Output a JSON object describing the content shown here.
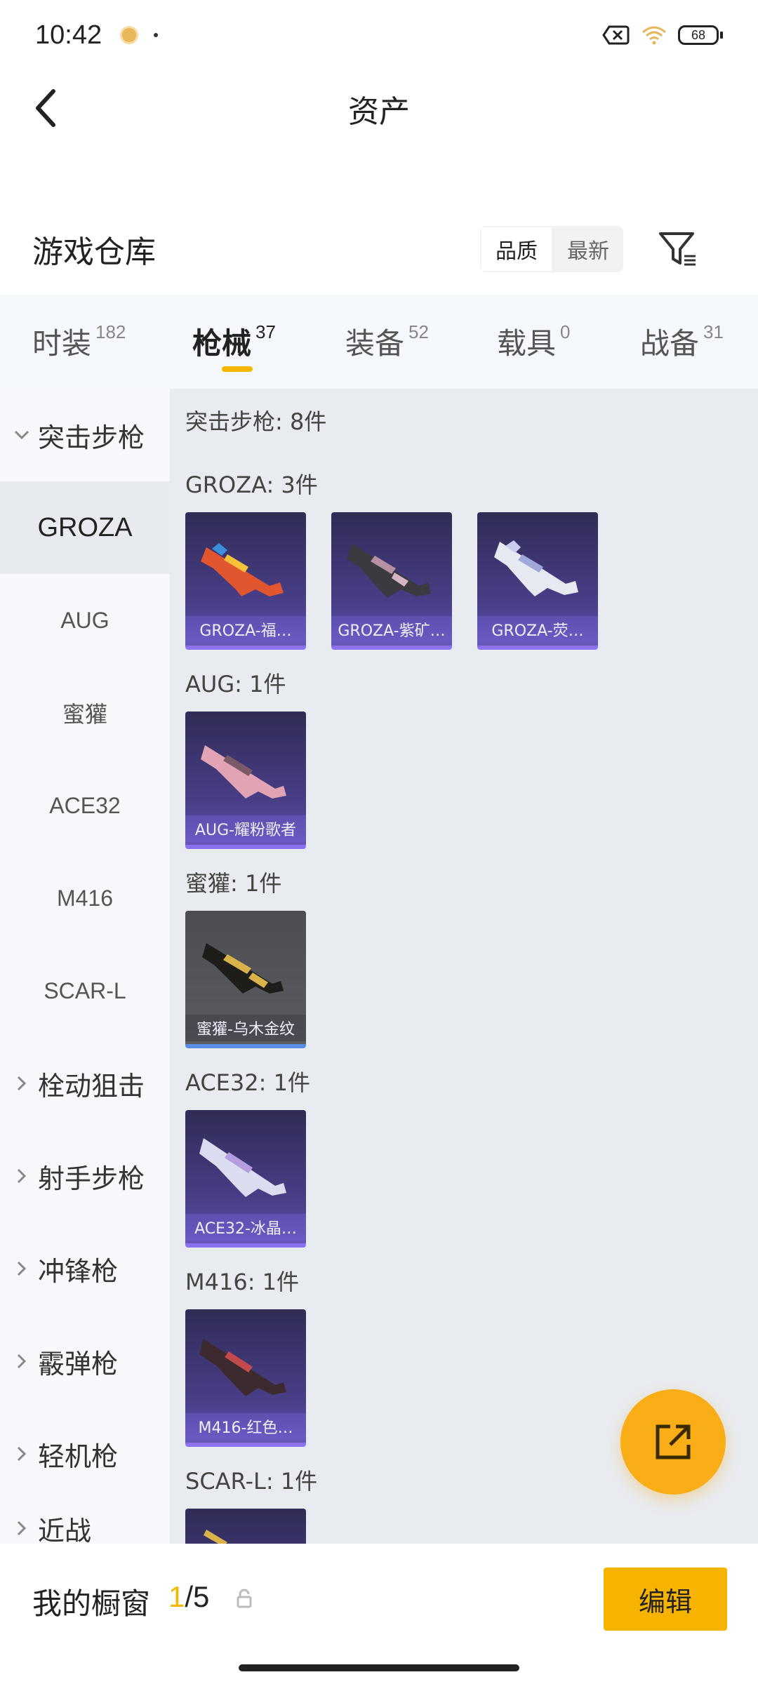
{
  "status_bar": {
    "time": "10:42",
    "battery": "68",
    "icons": [
      "notification-icon",
      "close-box-icon",
      "wifi-icon",
      "battery-icon"
    ]
  },
  "header": {
    "title": "资产",
    "back_icon": "chevron-left-icon"
  },
  "warehouse": {
    "title": "游戏仓库",
    "sort_options": [
      "品质",
      "最新"
    ],
    "sort_selected": "品质",
    "filter_icon": "filter-icon"
  },
  "tabs": [
    {
      "label": "时装",
      "count": "182"
    },
    {
      "label": "枪械",
      "count": "37"
    },
    {
      "label": "装备",
      "count": "52"
    },
    {
      "label": "载具",
      "count": "0"
    },
    {
      "label": "战备",
      "count": "31"
    }
  ],
  "active_tab": "枪械",
  "sidebar": {
    "expanded_category": "突击步枪",
    "subcategories": [
      "GROZA",
      "AUG",
      "蜜獾",
      "ACE32",
      "M416",
      "SCAR-L"
    ],
    "active_subcategory": "GROZA",
    "other_categories": [
      "栓动狙击",
      "射手步枪",
      "冲锋枪",
      "霰弹枪",
      "轻机枪",
      "近战"
    ]
  },
  "content": {
    "category_header": "突击步枪: 8件",
    "groups": [
      {
        "header": "GROZA: 3件",
        "items": [
          "GROZA-福…",
          "GROZA-紫矿…",
          "GROZA-荧…"
        ]
      },
      {
        "header": "AUG: 1件",
        "items": [
          "AUG-耀粉歌者"
        ]
      },
      {
        "header": "蜜獾: 1件",
        "items": [
          "蜜獾-乌木金纹"
        ]
      },
      {
        "header": "ACE32: 1件",
        "items": [
          "ACE32-冰晶…"
        ]
      },
      {
        "header": "M416: 1件",
        "items": [
          "M416-红色…"
        ]
      },
      {
        "header": "SCAR-L: 1件",
        "items": [
          ""
        ]
      }
    ]
  },
  "share_fab_icon": "share-icon",
  "bottom_bar": {
    "showcase_label": "我的橱窗",
    "showcase_current": "1",
    "showcase_total": "/5",
    "lock_icon": "lock-icon",
    "edit_label": "编辑"
  },
  "colors": {
    "accent": "#f6b400",
    "tab_bg": "#f5f8fd",
    "content_bg": "#e8ebf0",
    "card_purple": "#4a3f8a",
    "card_gray": "#5a5c61"
  }
}
